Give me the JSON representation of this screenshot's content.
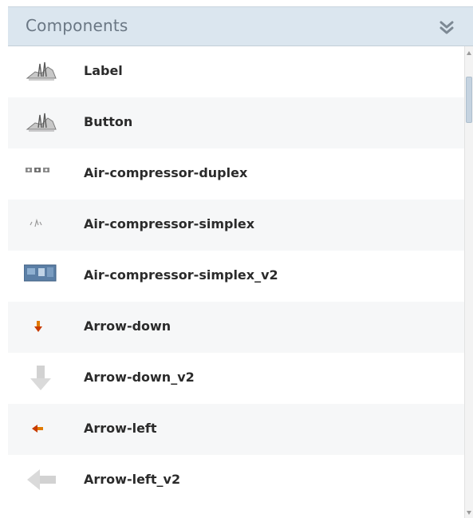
{
  "panel": {
    "title": "Components",
    "collapse_icon": "double-chevron-down-icon"
  },
  "items": [
    {
      "label": "Label",
      "icon": "hand-drawing-icon"
    },
    {
      "label": "Button",
      "icon": "hand-drawing-icon"
    },
    {
      "label": "Air-compressor-duplex",
      "icon": "air-compressor-duplex-icon"
    },
    {
      "label": "Air-compressor-simplex",
      "icon": "air-compressor-simplex-icon"
    },
    {
      "label": "Air-compressor-simplex_v2",
      "icon": "air-compressor-panel-icon"
    },
    {
      "label": "Arrow-down",
      "icon": "arrow-down-small-icon"
    },
    {
      "label": "Arrow-down_v2",
      "icon": "arrow-down-gray-icon"
    },
    {
      "label": "Arrow-left",
      "icon": "arrow-left-small-icon"
    },
    {
      "label": "Arrow-left_v2",
      "icon": "arrow-left-gray-icon"
    }
  ],
  "colors": {
    "header_bg": "#dbe6ef",
    "header_text": "#6a7784",
    "alt_row": "#f6f7f8",
    "label_text": "#2b2b2b"
  }
}
